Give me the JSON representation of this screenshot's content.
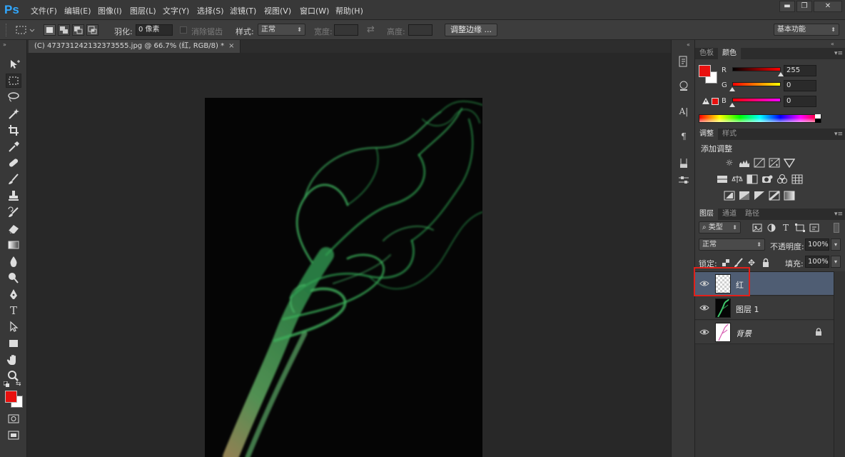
{
  "app": {
    "logo": "Ps"
  },
  "menu": [
    "文件(F)",
    "编辑(E)",
    "图像(I)",
    "图层(L)",
    "文字(Y)",
    "选择(S)",
    "滤镜(T)",
    "视图(V)",
    "窗口(W)",
    "帮助(H)"
  ],
  "window_controls": {
    "minimize": "▬",
    "restore": "❐",
    "close": "✕"
  },
  "options": {
    "feather_label": "羽化:",
    "feather_value": "0 像素",
    "antialias_label": "消除锯齿",
    "style_label": "样式:",
    "style_value": "正常",
    "width_label": "宽度:",
    "height_label": "高度:",
    "refine_edge_button": "调整边缘 ...",
    "workspace_value": "基本功能"
  },
  "document": {
    "tab_title": "(C) 473731242132373555.jpg @ 66.7% (红, RGB/8) *",
    "close_glyph": "×"
  },
  "color_panel": {
    "tabs": [
      "色板",
      "颜色"
    ],
    "active_tab": "颜色",
    "channels": [
      {
        "label": "R",
        "value": "255",
        "level": 1.0
      },
      {
        "label": "G",
        "value": "0",
        "level": 0.0
      },
      {
        "label": "B",
        "value": "0",
        "level": 0.0
      }
    ],
    "foreground": "#e8110f",
    "background": "#ffffff"
  },
  "adjust_panel": {
    "tabs": [
      "调整",
      "样式"
    ],
    "active_tab": "调整",
    "heading": "添加调整"
  },
  "layers_panel": {
    "tabs": [
      "图层",
      "通道",
      "路径"
    ],
    "active_tab": "图层",
    "filter_kind": "类型",
    "blend_mode": "正常",
    "opacity_label": "不透明度:",
    "opacity_value": "100%",
    "lock_label": "锁定:",
    "fill_label": "填充:",
    "fill_value": "100%",
    "layers": [
      {
        "name": "红",
        "selected": true,
        "thumb": "transparent",
        "locked": false
      },
      {
        "name": "图层 1",
        "selected": false,
        "thumb": "smoke",
        "locked": false
      },
      {
        "name": "背景",
        "selected": false,
        "thumb": "white-sketch",
        "locked": true
      }
    ]
  },
  "colors": {
    "smoke": "#3ec46a",
    "highlight_box": "#e0201a",
    "selected_layer": "#4f5d73"
  }
}
